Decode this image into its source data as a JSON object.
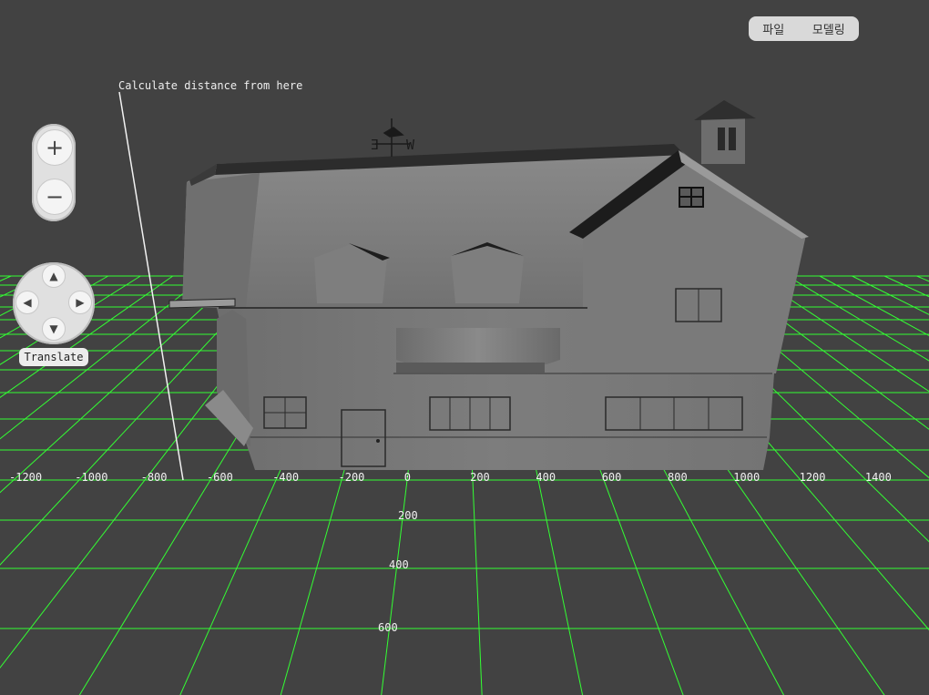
{
  "menu": {
    "file_label": "파일",
    "modeling_label": "모델링"
  },
  "measure": {
    "label": "Calculate distance from here"
  },
  "zoom": {
    "in_label": "+",
    "out_label": "−"
  },
  "pad": {
    "up": "▲",
    "down": "▼",
    "left": "◀",
    "right": "▶",
    "mode_label": "Translate"
  },
  "axis": {
    "x_ticks": [
      "-1200",
      "-1000",
      "-800",
      "-600",
      "-400",
      "-200",
      "0",
      "200",
      "400",
      "600",
      "800",
      "1000",
      "1200",
      "1400"
    ],
    "z_ticks": [
      "200",
      "400",
      "600"
    ]
  },
  "weather_vane": {
    "east": "E",
    "west": "W"
  },
  "colors": {
    "background": "#424242",
    "grid": "#33ff33",
    "model": "#7a7a7a"
  }
}
